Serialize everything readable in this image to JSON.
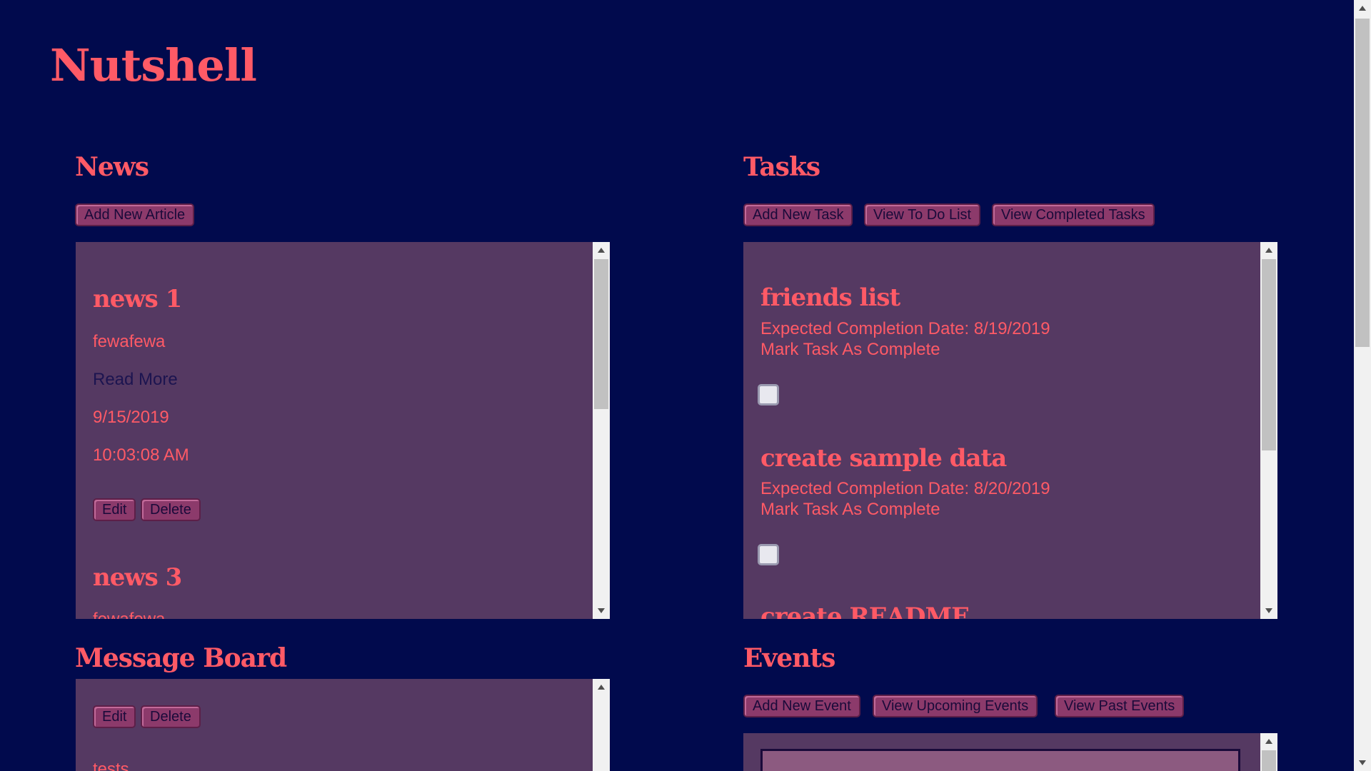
{
  "app": {
    "title": "Nutshell"
  },
  "news": {
    "title": "News",
    "add_button": "Add New Article",
    "articles": [
      {
        "title": "news 1",
        "synopsis": "fewafewa",
        "link": "Read More",
        "date": "9/15/2019",
        "time": "10:03:08 AM",
        "edit": "Edit",
        "delete": "Delete"
      },
      {
        "title": "news 3",
        "synopsis": "fewafewa"
      }
    ]
  },
  "tasks": {
    "title": "Tasks",
    "buttons": [
      "Add New Task",
      "View To Do List",
      "View Completed Tasks"
    ],
    "items": [
      {
        "title": "friends list",
        "due": "Expected Completion Date: 8/19/2019",
        "mark": "Mark Task As Complete",
        "checked": false
      },
      {
        "title": "create sample data",
        "due": "Expected Completion Date: 8/20/2019",
        "mark": "Mark Task As Complete",
        "checked": false
      },
      {
        "title": "create README"
      }
    ]
  },
  "messages": {
    "title": "Message Board",
    "edit": "Edit",
    "delete": "Delete",
    "first_message": "tests"
  },
  "events": {
    "title": "Events",
    "buttons": [
      "Add New Event",
      "View Upcoming Events",
      "View Past Events"
    ]
  },
  "colors": {
    "background": "#010a4d",
    "accent": "#ff5a66",
    "panel": "#553962",
    "button": "#8c3a6b"
  }
}
